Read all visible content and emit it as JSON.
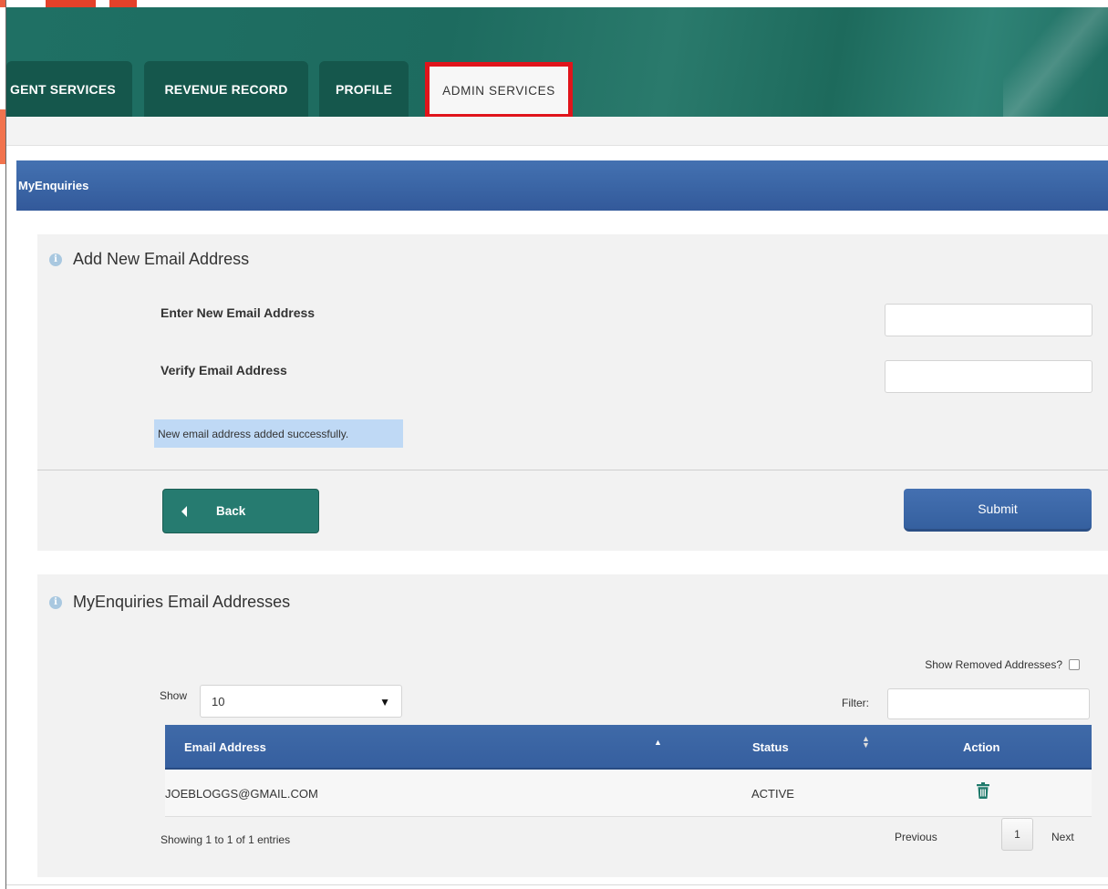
{
  "nav": {
    "tabs": [
      {
        "label": "GENT SERVICES"
      },
      {
        "label": "REVENUE RECORD"
      },
      {
        "label": "PROFILE"
      },
      {
        "label": "ADMIN SERVICES"
      }
    ],
    "active_tab": "ADMIN SERVICES"
  },
  "section_bar": {
    "title": "MyEnquiries"
  },
  "add_email": {
    "title": "Add New Email Address",
    "new_email_label": "Enter New Email Address",
    "new_email_value": "",
    "verify_email_label": "Verify Email Address",
    "verify_email_value": "",
    "success_message": "New email address added successfully.",
    "back_label": "Back",
    "submit_label": "Submit"
  },
  "addresses": {
    "title": "MyEnquiries Email Addresses",
    "show_removed_label": "Show Removed Addresses?",
    "show_removed_checked": false,
    "show_label": "Show",
    "page_length": "10",
    "filter_label": "Filter:",
    "filter_value": "",
    "columns": [
      "Email Address",
      "Status",
      "Action"
    ],
    "rows": [
      {
        "email": "JOEBLOGGS@GMAIL.COM",
        "status": "ACTIVE",
        "action_icon": "trash-icon"
      }
    ],
    "info": "Showing 1 to 1 of 1 entries",
    "pagination": {
      "previous": "Previous",
      "current_page": "1",
      "next": "Next"
    }
  },
  "colors": {
    "header_green": "#1f7064",
    "tab_green": "#15574c",
    "active_tab_outline": "#e0141b",
    "bar_blue": "#3b66a6",
    "success_bg": "#bfd9f5",
    "back_button": "#267b70"
  }
}
